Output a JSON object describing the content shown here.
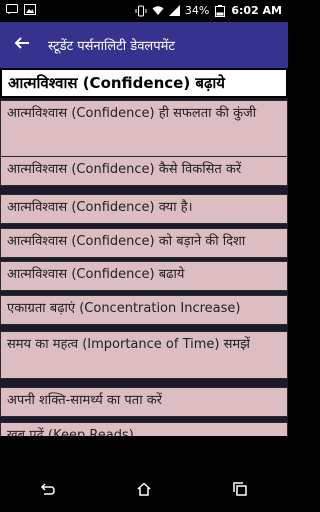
{
  "status_bar": {
    "battery": "34%",
    "time": "6:02 AM",
    "icons": [
      "message-icon",
      "photo-icon",
      "vibrate-icon",
      "wifi-icon",
      "signal-icon",
      "battery-icon"
    ]
  },
  "app_bar": {
    "title": "स्टूडेंट पर्सनालिटी डेवलपमेंट",
    "back_icon": "arrow-left-icon"
  },
  "heading": "आत्मविश्वास (Confidence) बढ़ाये",
  "list": {
    "items": [
      "आत्मविश्वास (Confidence) ही सफलता की कुंजी",
      "आत्मविश्वास (Confidence) कैसे विकसित करें",
      "आत्मविश्वास (Confidence) क्या है।",
      "आत्मविश्वास (Confidence) को बड़ाने की दिशा",
      "आत्मविश्वास (Confidence) बढाये",
      "एकाग्रता बढ़ाएं (Concentration Increase)",
      "समय का महत्व (Importance of Time) समझें",
      "अपनी शक्ति-सामर्थ्य का पता करें",
      "खूब पढ़ें (Keep Reads)"
    ]
  },
  "nav_bar": {
    "icons": [
      "back-icon",
      "home-icon",
      "recents-icon"
    ]
  },
  "colors": {
    "app_bar": "#36338f",
    "item_bg": "#dcbec2",
    "list_bg": "#1b1a2b"
  }
}
